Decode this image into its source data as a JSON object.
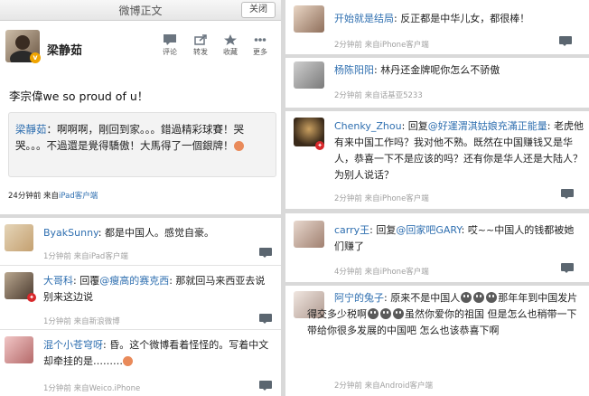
{
  "main": {
    "window_title": "微博正文",
    "close_label": "关闭",
    "username": "梁静茹",
    "verified_badge": "v",
    "actions": [
      {
        "label": "评论",
        "icon": "comment-icon"
      },
      {
        "label": "转发",
        "icon": "repost-icon"
      },
      {
        "label": "收藏",
        "icon": "star-icon"
      },
      {
        "label": "更多",
        "icon": "more-icon"
      }
    ],
    "text": "李宗偉we so proud of u！",
    "quote": {
      "author": "梁靜茹",
      "text": "：啊啊啊，剛回到家。。。錯過精彩球賽！哭哭。。。不過還是覺得驕傲！大馬得了一個銀牌！"
    },
    "time": "24分钟前",
    "source_prefix": "来自",
    "source": "iPad客户端"
  },
  "comments_left": [
    {
      "user": "ByakSunny",
      "text": "都是中国人。感觉自豪。",
      "meta": "1分钟前 来自iPad客户端"
    },
    {
      "user": "大哥科",
      "reply_word": "回覆",
      "mention": "@瘦高的赛克西",
      "text_after": "那就回马来西亚去说 别来这边说",
      "meta": "1分钟前 来自新浪微博"
    },
    {
      "user": "混个小苍穹呀",
      "text": "昏。这个微博看着怪怪的。写着中文却牵挂的是………",
      "meta": "1分钟前 来自Weico.iPhone"
    }
  ],
  "comments_right": [
    {
      "user": "开始就是结局",
      "text": "反正都是中华儿女，都很棒！",
      "meta": "2分钟前 来自iPhone客户端"
    },
    {
      "user": "杨陈阳阳",
      "text": "林丹还金牌呢你怎么不骄傲",
      "meta": "2分钟前 来自话基亚5233"
    },
    {
      "user": "Chenky_Zhou",
      "reply_word": "回复",
      "mention": "@好運渭淇姑娘充滿正能量",
      "text_after": "老虎他有来中国工作吗？我对他不熟。既然在中国赚钱又是华人，恭喜一下不是应该的吗？还有你是华人还是大陆人？为别人说话？",
      "meta": "2分钟前 来自iPhone客户端"
    },
    {
      "user": "carry王",
      "reply_word": "回复",
      "mention": "@回家吧GARY",
      "text_after": "哎~~中国人的钱都被她们赚了",
      "meta": "4分钟前 来自iPhone客户端"
    },
    {
      "user": "阿宁的兔子",
      "text_a": "原来不是中国人",
      "text_b": "那年年到中国发片得交多少税啊",
      "text_c": "虽然你爱你的祖国  但是怎么也稍带一下带给你很多发展的中国吧 怎么也该恭喜下啊",
      "meta": "2分钟前 来自Android客户端"
    }
  ],
  "colors": {
    "link": "#2f6fb0",
    "meta": "#a0a0a0",
    "accent_v": "#f0a400"
  }
}
